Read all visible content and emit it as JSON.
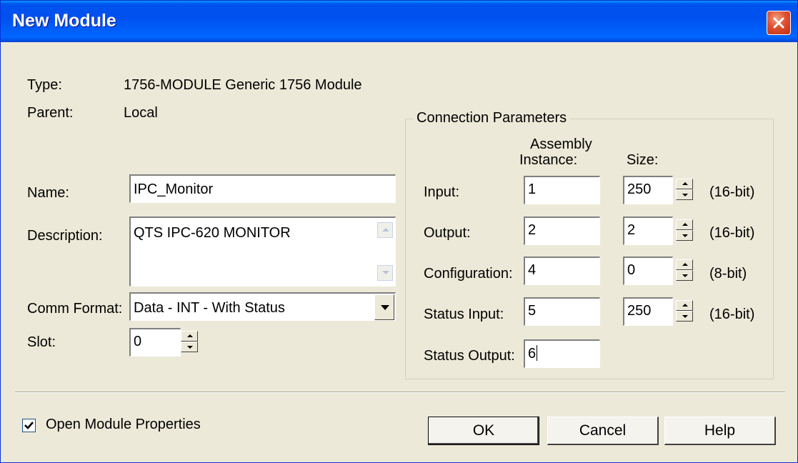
{
  "window": {
    "title": "New Module"
  },
  "type": {
    "label": "Type:",
    "value": "1756-MODULE Generic 1756 Module"
  },
  "parent": {
    "label": "Parent:",
    "value": "Local"
  },
  "name": {
    "label": "Name:",
    "value": "IPC_Monitor"
  },
  "description": {
    "label": "Description:",
    "value": "QTS IPC-620 MONITOR"
  },
  "comm_format": {
    "label": "Comm Format:",
    "value": "Data - INT - With Status"
  },
  "slot": {
    "label": "Slot:",
    "value": "0"
  },
  "connection": {
    "title": "Connection Parameters",
    "col_assembly_1": "Assembly",
    "col_assembly_2": "Instance:",
    "col_size": "Size:",
    "rows": [
      {
        "label": "Input:",
        "instance": "1",
        "size": "250",
        "unit": "(16-bit)"
      },
      {
        "label": "Output:",
        "instance": "2",
        "size": "2",
        "unit": "(16-bit)"
      },
      {
        "label": "Configuration:",
        "instance": "4",
        "size": "0",
        "unit": "(8-bit)"
      },
      {
        "label": "Status Input:",
        "instance": "5",
        "size": "250",
        "unit": "(16-bit)"
      },
      {
        "label": "Status Output:",
        "instance": "6"
      }
    ]
  },
  "open_props": {
    "label": "Open Module Properties",
    "checked": true
  },
  "buttons": {
    "ok": "OK",
    "cancel": "Cancel",
    "help": "Help"
  }
}
